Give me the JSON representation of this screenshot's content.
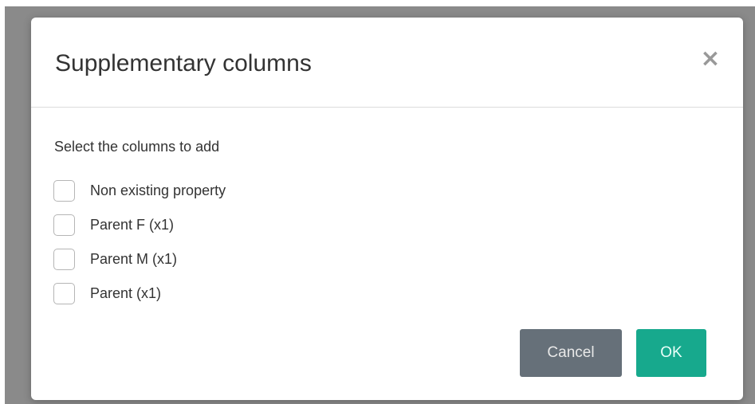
{
  "dialog": {
    "title": "Supplementary columns",
    "close_icon": "×",
    "instruction": "Select the columns to add",
    "options": [
      {
        "label": "Non existing property",
        "checked": false
      },
      {
        "label": "Parent F (x1)",
        "checked": false
      },
      {
        "label": "Parent M (x1)",
        "checked": false
      },
      {
        "label": "Parent (x1)",
        "checked": false
      }
    ],
    "cancel_label": "Cancel",
    "ok_label": "OK"
  },
  "colors": {
    "backdrop": "#8a8a8a",
    "cancel_button": "#667079",
    "ok_button": "#17a98d"
  }
}
